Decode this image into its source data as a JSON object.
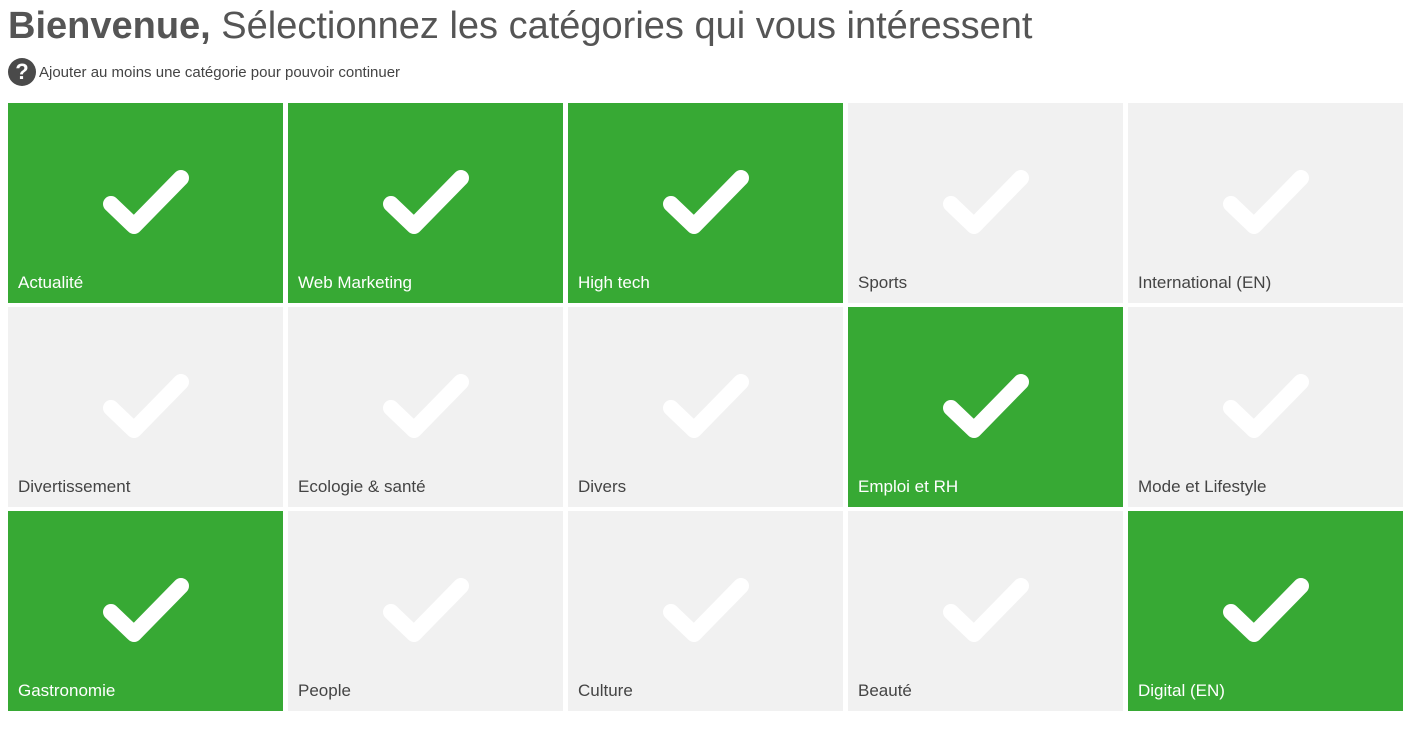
{
  "header": {
    "title_strong": "Bienvenue,",
    "title_rest": " Sélectionnez les catégories qui vous intéressent",
    "hint_icon": "question-circle-icon",
    "hint_text": "Ajouter au moins une catégorie pour pouvoir continuer"
  },
  "colors": {
    "selected": "#37a934",
    "unselected": "#f1f1f1"
  },
  "categories": [
    {
      "label": "Actualité",
      "selected": true,
      "icon": "check-icon"
    },
    {
      "label": "Web Marketing",
      "selected": true,
      "icon": "check-icon"
    },
    {
      "label": "High tech",
      "selected": true,
      "icon": "check-icon"
    },
    {
      "label": "Sports",
      "selected": false,
      "icon": "check-icon"
    },
    {
      "label": "International (EN)",
      "selected": false,
      "icon": "check-icon"
    },
    {
      "label": "Divertissement",
      "selected": false,
      "icon": "check-icon"
    },
    {
      "label": "Ecologie & santé",
      "selected": false,
      "icon": "check-icon"
    },
    {
      "label": "Divers",
      "selected": false,
      "icon": "check-icon"
    },
    {
      "label": "Emploi et RH",
      "selected": true,
      "icon": "check-icon"
    },
    {
      "label": "Mode et Lifestyle",
      "selected": false,
      "icon": "check-icon"
    },
    {
      "label": "Gastronomie",
      "selected": true,
      "icon": "check-icon"
    },
    {
      "label": "People",
      "selected": false,
      "icon": "check-icon"
    },
    {
      "label": "Culture",
      "selected": false,
      "icon": "check-icon"
    },
    {
      "label": "Beauté",
      "selected": false,
      "icon": "check-icon"
    },
    {
      "label": "Digital (EN)",
      "selected": true,
      "icon": "check-icon"
    }
  ]
}
